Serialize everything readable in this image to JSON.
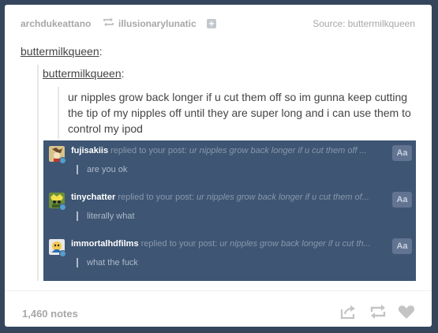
{
  "header": {
    "user1": "archdukeattano",
    "reblog_icon": "reblog-icon",
    "user2": "illusionarylunatic",
    "follow_icon": "plus-icon",
    "follow_glyph": "+",
    "source_label": "Source:",
    "source_name": "buttermilkqueen"
  },
  "post": {
    "author1": "buttermilkqueen",
    "author2": "buttermilkqueen",
    "colon": ":",
    "text": "ur nipples grow back longer if u cut them off so im gunna keep cutting the tip of my nipples off until they are super long and i can use them to control my ipod"
  },
  "replies": [
    {
      "username": "fujisakiis",
      "replied_text": "replied to your post:",
      "quote": "ur nipples grow back longer if u cut them off ...",
      "reply": "are you ok",
      "button": "Aa"
    },
    {
      "username": "tinychatter",
      "replied_text": "replied to your post:",
      "quote": "ur nipples grow back longer if u cut them of...",
      "reply": "literally what",
      "button": "Aa"
    },
    {
      "username": "immortalhdfilms",
      "replied_text": "replied to your post:",
      "quote": "ur nipples grow back longer if u cut th...",
      "reply": "what the fuck",
      "button": "Aa"
    }
  ],
  "footer": {
    "notes": "1,460 notes",
    "icons": [
      "share-icon",
      "reblog-icon",
      "like-heart-icon"
    ]
  },
  "colors": {
    "background": "#35465c",
    "card": "#ffffff",
    "replies_panel": "#3e5573",
    "muted_text": "#a7a7a7",
    "accent": "#529ecc"
  }
}
